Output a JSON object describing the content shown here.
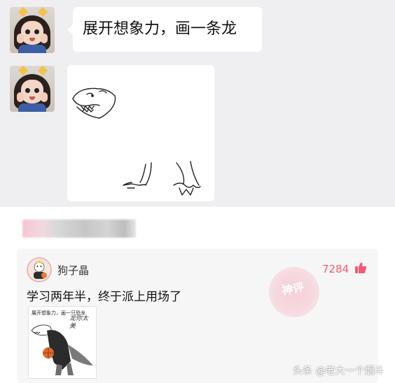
{
  "chat": {
    "message_text": "展开想象力，画一条龙",
    "user_avatar_icon": "girl-avatar-icon",
    "drawing_icon": "dinosaur-sketch-icon"
  },
  "comment": {
    "username": "狗子晶",
    "likes": "7284",
    "like_icon": "thumbs-up-icon",
    "text": "学习两年半，终于派上用场了",
    "badge_text": "神评",
    "thumbnail": {
      "caption": "展开想象力，画一只恐龙",
      "script_text": "龙你太美",
      "icon": "dinosaur-basketball-meme-icon"
    }
  },
  "watermark": "头条 @老大一个烟斗",
  "colors": {
    "chat_bg": "#efeff1",
    "bubble": "#ffffff",
    "accent_pink": "#f15a70",
    "card_bg": "#f6f6f7"
  }
}
